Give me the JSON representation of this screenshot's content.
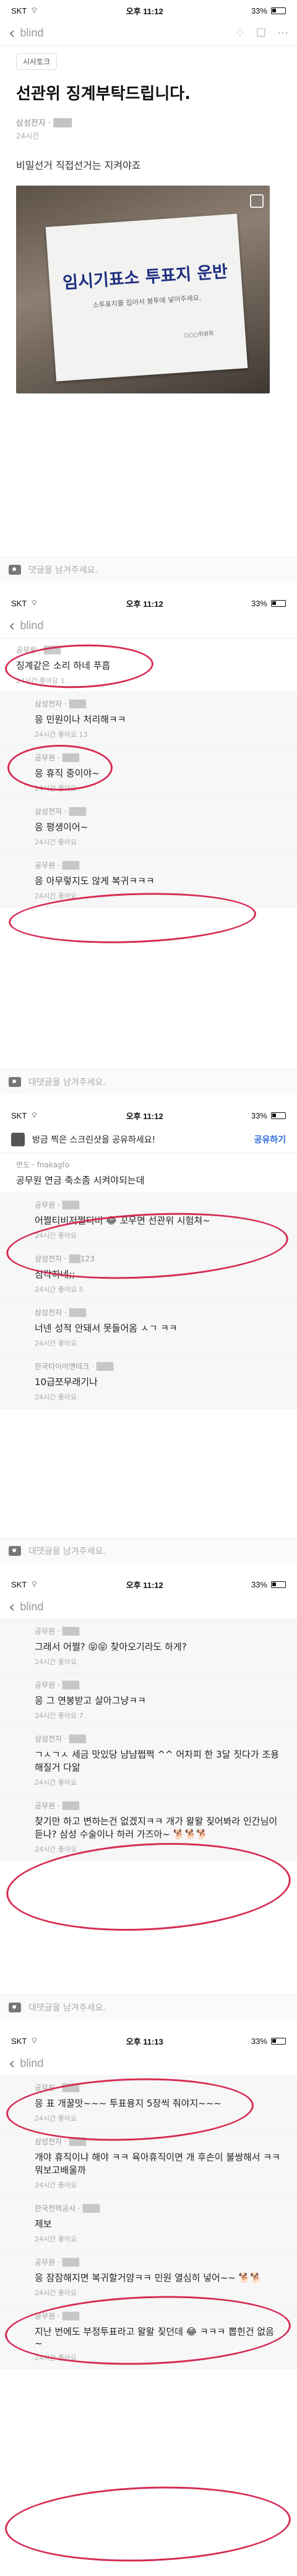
{
  "status": {
    "carrier": "SKT",
    "time1": "오후 11:12",
    "time2": "오후 11:13",
    "battery": "33%"
  },
  "brand": "blind",
  "post": {
    "tag": "시사토크",
    "title": "선관위 징계부탁드립니다.",
    "company": "삼성전자 · ▒▒▒",
    "time": "24시간",
    "body": "비밀선거 직접선거는 지켜야죠",
    "photo_text": "임시기표소 투표지 운반",
    "photo_sub": "소투표지를 집어서 봉투에 넣어주세요.",
    "photo_seal": "○○○위원회"
  },
  "reply_placeholder": "댓글을 남겨주세요.",
  "reply_placeholder2": "대댓글을 남겨주세요.",
  "share": {
    "text": "방금 찍은 스크린샷을 공유하세요!",
    "button": "공유하기"
  },
  "panel2": [
    {
      "who": "공무원 · ▒▒▒",
      "text": "징계같은 소리 하네 푸흡",
      "foot": "24시간    좋아요 1",
      "sub": false
    },
    {
      "who": "삼성전자 · ▒▒▒",
      "text": "응 민원이나 처리해ㅋㅋ",
      "foot": "24시간    좋아요 13",
      "sub": true
    },
    {
      "who": "공무원 · ▒▒▒",
      "text": "응 휴직 중이야~",
      "foot": "24시간    좋아요",
      "sub": true
    },
    {
      "who": "삼성전자 · ▒▒▒",
      "text": "응 평생이어~",
      "foot": "24시간    좋아요",
      "sub": true
    },
    {
      "who": "공무원 · ▒▒▒",
      "text": "응 아무렇지도 않게 복귀ㅋㅋㅋ",
      "foot": "24시간    좋아요",
      "sub": true
    }
  ],
  "panel3": [
    {
      "who": "면도 · fnakagfo",
      "text": "공무원 연금 축소좀 시켜야되는데",
      "foot": "",
      "sub": false
    },
    {
      "who": "공무원 · ▒▒▒",
      "text": "어쩔티비저쩔티비 😂 꼬우면 선관위 시험쳐~",
      "foot": "24시간    좋아요",
      "sub": true
    },
    {
      "who": "삼성전자 · ▒▒123",
      "text": "심각하네;;",
      "foot": "24시간    좋아요 5",
      "sub": true
    },
    {
      "who": "삼성전자 · ▒▒▒",
      "text": "너넨 성적 안돼서 못들어옴 ㅅㄱ ㅋㅋ",
      "foot": "24시간    좋아요",
      "sub": true
    },
    {
      "who": "한국타이어앤테크 · ▒▒▒",
      "text": "10급쪼무래기나",
      "foot": "24시간    좋아요",
      "sub": true
    }
  ],
  "panel4": [
    {
      "who": "공무원 · ▒▒▒",
      "text": "그래서 어쩔? 😝😝 찾아오기라도 하게?",
      "foot": "24시간    좋아요",
      "sub": true
    },
    {
      "who": "공무원 · ▒▒▒",
      "text": "응 그 연봉받고 살아그냥ㅋㅋ",
      "foot": "24시간    좋아요 7",
      "sub": true
    },
    {
      "who": "삼성전자 · ▒▒▒",
      "text": "ㄱㅅㄱㅅ 세금 맛있당 냠냠쩝쩍 ^^ 어차피 한 3달 짓다가 조용해질거 다앎",
      "foot": "24시간    좋아요",
      "sub": true
    },
    {
      "who": "공무원 · ▒▒▒",
      "text": "찾기만 하고 변하는건 없겠지ㅋㅋ 개가 왈왈 짖어봐라 인간님이 듣나? 삼성 수술이나 하러 가즈아~ 🐕🐕🐕",
      "foot": "24시간    좋아요",
      "sub": true
    }
  ],
  "panel5": [
    {
      "who": "공무원 · ▒▒▒",
      "text": "응 표 개꿀맛~~~ 투표용지 5장씩 줘야지~~~",
      "foot": "24시간    좋아요",
      "sub": true
    },
    {
      "who": "삼성전자 · ▒▒▒",
      "text": "개야 휴직이냐 해야 ㅋㅋ 육아휴직이면 개 후손이 불쌍해서 ㅋㅋ 뭐보고배울까",
      "foot": "24시간    좋아요",
      "sub": true
    },
    {
      "who": "한국전력공사 · ▒▒▒",
      "text": "제보",
      "foot": "24시간    좋아요",
      "sub": true
    },
    {
      "who": "공무원 · ▒▒▒",
      "text": "응 잠잠해지면 복귀할거얌ㅋㅋ 민원 열심히 넣어~~ 🐕🐕",
      "foot": "24시간    좋아요",
      "sub": true
    },
    {
      "who": "공무원 · ▒▒▒",
      "text": "지난 번에도 부정투표라고 왈왈 짖던데 😂 ㅋㅋㅋ 뽑힌건 없음~",
      "foot": "24시간    좋아요",
      "sub": true
    }
  ],
  "icons": {
    "back": "chevron-left-icon",
    "camera": "camera-icon",
    "bell": "bell-icon",
    "more": "more-icon"
  },
  "colors": {
    "annotation": "#d62b52",
    "share_button": "#2a6ad9"
  }
}
